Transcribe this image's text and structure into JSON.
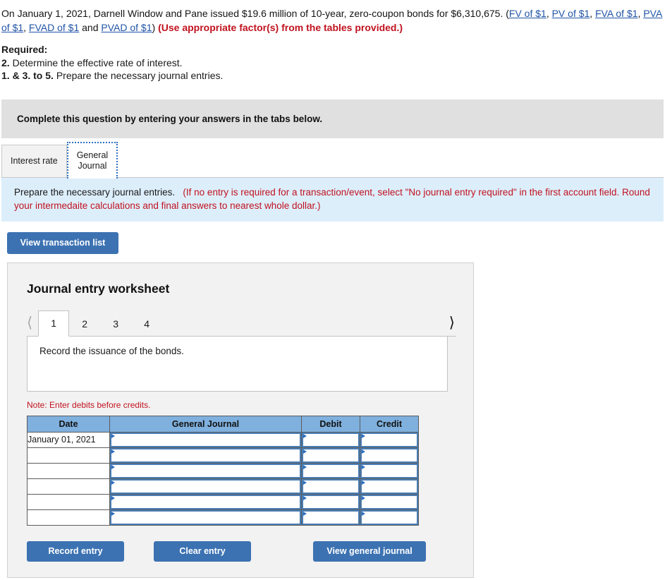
{
  "problem": {
    "intro_before_links": "On January 1, 2021, Darnell Window and Pane issued $19.6 million of 10-year, zero-coupon bonds for $6,310,675. (",
    "links": [
      "FV of $1",
      "PV of $1",
      "FVA of $1",
      "PVA of $1",
      "FVAD of $1",
      "PVAD of $1"
    ],
    "and_word": "and",
    "close_paren": ")",
    "instruction_red": "(Use appropriate factor(s) from the tables provided.)"
  },
  "required": {
    "heading": "Required:",
    "item_2_number": "2.",
    "item_2_text": "Determine the effective rate of interest.",
    "item_135_number": "1. & 3. to 5.",
    "item_135_text": "Prepare the necessary journal entries."
  },
  "banner": {
    "text": "Complete this question by entering your answers in the tabs below."
  },
  "tabs": [
    {
      "label": "Interest rate",
      "active": false
    },
    {
      "label": "General Journal",
      "line1": "General",
      "line2": "Journal",
      "active": true
    }
  ],
  "instruction_strip": {
    "main": "Prepare the necessary journal entries.",
    "hint": "(If no entry is required for a transaction/event, select \"No journal entry required\" in the first account field. Round your intermedaite calculations and final answers to nearest whole dollar.)"
  },
  "buttons": {
    "view_transaction_list": "View transaction list",
    "record_entry": "Record entry",
    "clear_entry": "Clear entry",
    "view_general_journal": "View general journal"
  },
  "worksheet": {
    "title": "Journal entry worksheet",
    "prev_icon": "chevron-left-icon",
    "next_icon": "chevron-right-icon",
    "pages": [
      "1",
      "2",
      "3",
      "4"
    ],
    "active_page": "1",
    "description": "Record the issuance of the bonds.",
    "note": "Note: Enter debits before credits."
  },
  "journal_table": {
    "columns": [
      "Date",
      "General Journal",
      "Debit",
      "Credit"
    ],
    "rows": [
      {
        "date": "January 01, 2021",
        "general_journal": "",
        "debit": "",
        "credit": ""
      },
      {
        "date": "",
        "general_journal": "",
        "debit": "",
        "credit": ""
      },
      {
        "date": "",
        "general_journal": "",
        "debit": "",
        "credit": ""
      },
      {
        "date": "",
        "general_journal": "",
        "debit": "",
        "credit": ""
      },
      {
        "date": "",
        "general_journal": "",
        "debit": "",
        "credit": ""
      },
      {
        "date": "",
        "general_journal": "",
        "debit": "",
        "credit": ""
      }
    ]
  },
  "colors": {
    "accent_blue": "#3c72b2",
    "table_header_blue": "#7fb0de",
    "link_blue": "#2154a6",
    "red": "#c1121f",
    "banner_gray": "#e0e0e0",
    "instruction_blue": "#ddeefb",
    "panel_gray": "#f2f2f2"
  }
}
